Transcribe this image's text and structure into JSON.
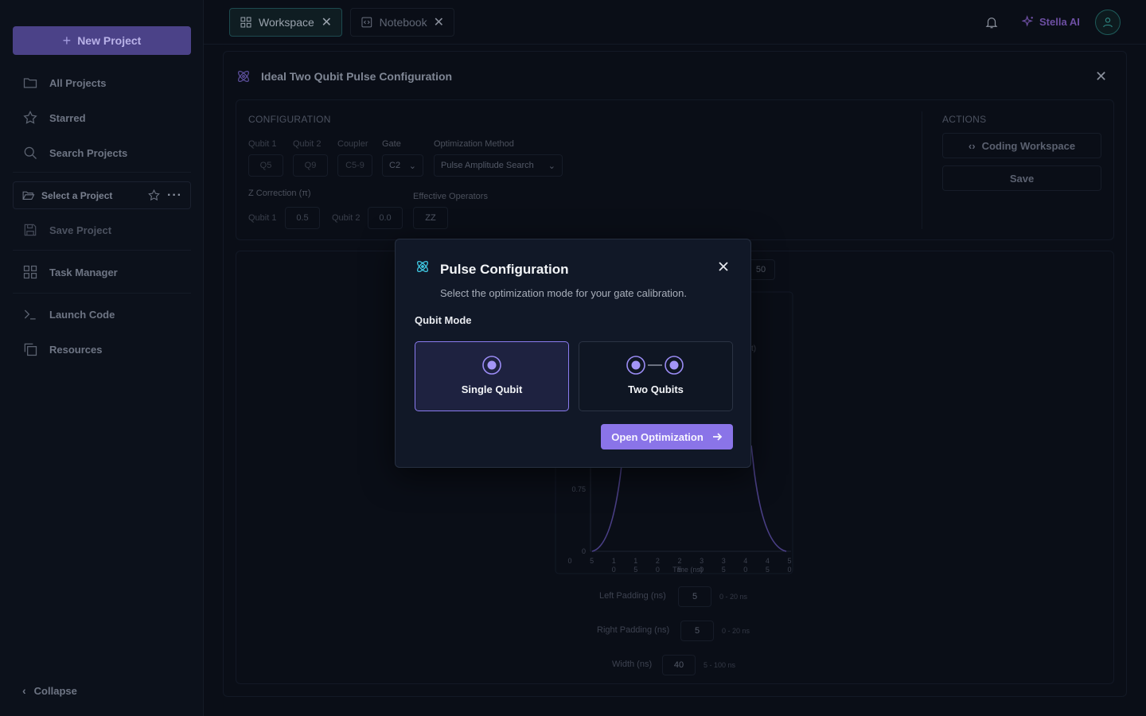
{
  "sidebar": {
    "new_project": "New Project",
    "items": [
      {
        "label": "All Projects",
        "icon": "folder-icon"
      },
      {
        "label": "Starred",
        "icon": "star-icon"
      },
      {
        "label": "Search Projects",
        "icon": "search-icon"
      }
    ],
    "select_project": "Select a Project",
    "save_project": "Save Project",
    "task_manager": "Task Manager",
    "launch_code": "Launch Code",
    "resources": "Resources",
    "collapse": "Collapse"
  },
  "tabs": [
    {
      "label": "Workspace",
      "active": true
    },
    {
      "label": "Notebook",
      "active": false
    }
  ],
  "header": {
    "assistant": "Stella AI"
  },
  "panel": {
    "title": "Ideal Two Qubit Pulse Configuration",
    "configuration_label": "CONFIGURATION",
    "actions_label": "ACTIONS",
    "fields": {
      "qubit1_label": "Qubit 1",
      "qubit1": "Q5",
      "qubit2_label": "Qubit 2",
      "qubit2": "Q9",
      "coupler_label": "Coupler",
      "coupler": "C5-9",
      "gate_label": "Gate",
      "gate": "C2",
      "method_label": "Optimization Method",
      "method": "Pulse Amplitude Search",
      "zcorr_label": "Z Correction (π)",
      "zq1_label": "Qubit 1",
      "zq1": "0.5",
      "zq2_label": "Qubit 2",
      "zq2": "0.0",
      "effops_label": "Effective Operators",
      "effops": "ZZ"
    },
    "actions": {
      "coding_workspace": "Coding Workspace",
      "save": "Save"
    }
  },
  "chart_area": {
    "peek_value": "50",
    "peek_suffix": "t)",
    "ytick_075": "0.75",
    "ytick_0": "0",
    "xticks": [
      [
        "0",
        ""
      ],
      [
        "5",
        ""
      ],
      [
        "1",
        "0"
      ],
      [
        "1",
        "5"
      ],
      [
        "2",
        "0"
      ],
      [
        "2",
        "5"
      ],
      [
        "3",
        "0"
      ],
      [
        "3",
        "5"
      ],
      [
        "4",
        "0"
      ],
      [
        "4",
        "5"
      ],
      [
        "5",
        "0"
      ]
    ],
    "xlabel": "Time (ns)",
    "left_padding_label": "Left Padding (ns)",
    "left_padding": "5",
    "left_padding_hint": "0 - 20 ns",
    "right_padding_label": "Right Padding (ns)",
    "right_padding": "5",
    "right_padding_hint": "0 - 20 ns",
    "width_label": "Width (ns)",
    "width": "40",
    "width_hint": "5 - 100 ns"
  },
  "modal": {
    "title": "Pulse Configuration",
    "subtitle": "Select the optimization mode for your gate calibration.",
    "qubit_mode_label": "Qubit Mode",
    "options": [
      {
        "label": "Single Qubit",
        "selected": true
      },
      {
        "label": "Two Qubits",
        "selected": false
      }
    ],
    "open_button": "Open Optimization"
  },
  "colors": {
    "accent": "#8a74e8",
    "teal": "#1d4a4f",
    "modal_bg": "#111827"
  }
}
